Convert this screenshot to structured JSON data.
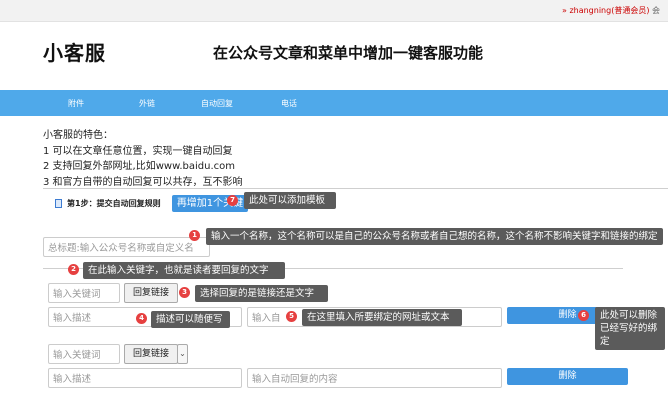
{
  "topbar": {
    "user": "» zhangning(普通会员)",
    "truncated": "会"
  },
  "header": {
    "logo": "小客服",
    "title": "在公众号文章和菜单中增加一键客服功能"
  },
  "nav": {
    "items": [
      "附件",
      "外链",
      "自动回复",
      "电话"
    ]
  },
  "intro": {
    "lines": [
      "小客服的特色：",
      "1 可以在文章任意位置，实现一键自动回复",
      "2 支持回复外部网址,比如www.baidu.com",
      "3 和官方自带的自动回复可以共存，互不影响"
    ]
  },
  "step": {
    "label": "第1步：提交自动回复规则",
    "add_button": "再增加1个关键"
  },
  "form": {
    "title_placeholder": "总标题:输入公众号名称或自定义名",
    "rows": [
      {
        "keyword_placeholder": "输入关键词",
        "type_value": "回复链接",
        "desc_placeholder": "输入描述",
        "content_placeholder": "输入自",
        "delete_label": "删除"
      },
      {
        "keyword_placeholder": "输入关键词",
        "type_value": "回复链接",
        "desc_placeholder": "输入描述",
        "content_placeholder": "输入自动回复的内容",
        "delete_label": "删除"
      }
    ]
  },
  "tips": {
    "t1": "输入一个名称，这个名称可以是自己的公众号名称或者自己想的名称，这个名称不影响关键字和链接的绑定",
    "t2": "在此输入关键字，也就是读者要回复的文字",
    "t3": "选择回复的是链接还是文字",
    "t4": "描述可以随便写",
    "t5": "在这里填入所要绑定的网址或文本",
    "t6": "此处可以删除已经写好的绑定",
    "t7": "此处可以添加模板"
  },
  "badges": [
    "1",
    "2",
    "3",
    "4",
    "5",
    "6",
    "7"
  ],
  "colors": {
    "nav_bg": "#4fa9ea",
    "primary_button": "#3f95e0",
    "tooltip_bg": "#5b5b5b",
    "badge": "#e64040",
    "user_link": "#cc0000"
  }
}
